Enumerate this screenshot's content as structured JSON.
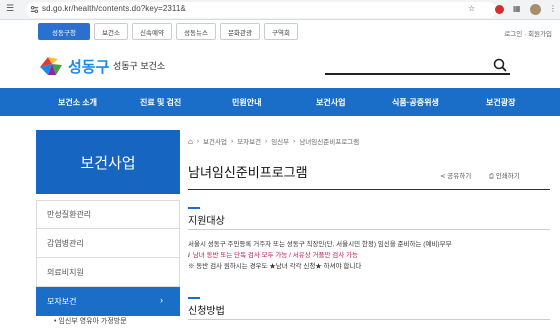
{
  "browser": {
    "url": "sd.go.kr/health/contents.do?key=2311&"
  },
  "top_tabs": [
    {
      "label": "성동구청"
    },
    {
      "label": "보건소"
    },
    {
      "label": "신속예약"
    },
    {
      "label": "성동뉴스"
    },
    {
      "label": "문화관광"
    },
    {
      "label": "구역회"
    }
  ],
  "util_links": {
    "login": "로그인",
    "join": "회원가입"
  },
  "header": {
    "logo_text": "성동구",
    "site_name": "성동구 보건소"
  },
  "nav": [
    "보건소 소개",
    "진료 및 검진",
    "민원안내",
    "보건사업",
    "식품·공중위생",
    "보건광장"
  ],
  "side": {
    "title": "보건사업",
    "items": [
      {
        "label": "만성질환관리"
      },
      {
        "label": "감염병관리"
      },
      {
        "label": "의료비지원"
      },
      {
        "label": "모자보건",
        "arrow": "›"
      }
    ],
    "sub_item": "• 임신부 영유아 가정방문"
  },
  "breadcrumb": [
    "보건사업",
    "모자보건",
    "임신부",
    "남녀임신준비프로그램"
  ],
  "page": {
    "title": "남녀임신준비프로그램",
    "share": "공유하기",
    "print": "인쇄하기",
    "sections": [
      {
        "title": "지원대상",
        "lines": [
          {
            "text": "서울시 성동구 주민등록 거주자 또는 성동구 직장인(단, 서울시민 한정) 임신을 준비하는 (예비)부부",
            "color": "#333"
          },
          {
            "text": "남녀 동반 또는 단독 검사 모두 가능 / 서유상 거플만 검사 가능",
            "color": "#c2185b"
          },
          {
            "text": "※ 동반 검사 원하시는 경우도 ★남녀 각각 신청★ 하셔야 합니다",
            "color": "#333"
          }
        ]
      },
      {
        "title": "신청방법"
      }
    ]
  },
  "colors": {
    "primary": "#1a6ec7",
    "side_title": "#1665c1",
    "warning": "#c2185b"
  }
}
